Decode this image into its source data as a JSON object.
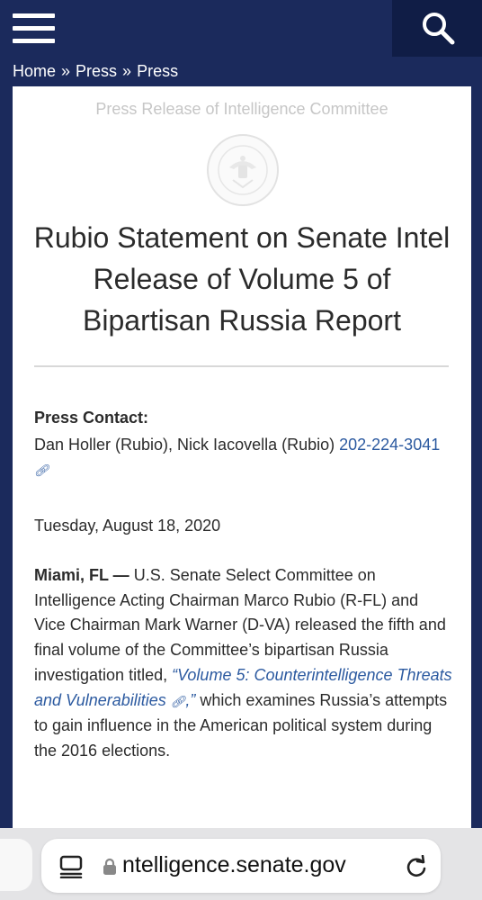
{
  "header": {
    "menu_icon": "hamburger-menu-icon",
    "search_icon": "search-icon",
    "brand_color": "#1b2a5c"
  },
  "breadcrumb": {
    "items": [
      "Home",
      "Press",
      "Press"
    ],
    "separator": "»"
  },
  "article": {
    "kicker": "Press Release of Intelligence Committee",
    "seal_icon": "united-states-senate-seal",
    "title": "Rubio Statement on Senate Intel Release of Volume 5 of Bipartisan Russia Report",
    "press_contact_label": "Press Contact:",
    "press_contact_names": "Dan Holler (Rubio), Nick Iacovella (Rubio) ",
    "press_contact_phone": "202-224-3041",
    "date": "Tuesday, August 18, 2020",
    "dateline": "Miami, FL —",
    "body_intro": " U.S. Senate Select Committee on Intelligence Acting Chairman Marco Rubio (R-FL) and Vice Chairman Mark Warner (D-VA) released the fifth and final volume of the Committee’s bipartisan Russia investigation titled, ",
    "body_link": "“Volume 5: Counterintelligence Threats and Vulnerabilities",
    "body_link_close": ",”",
    "body_outro": " which examines Russia’s attempts to gain influence in the American political system during the 2016 elections.",
    "link_color": "#2c5aa0"
  },
  "browser": {
    "url": "ntelligence.senate.gov",
    "reader_icon": "reader-mode-icon",
    "lock_icon": "lock-icon",
    "reload_icon": "reload-icon"
  }
}
